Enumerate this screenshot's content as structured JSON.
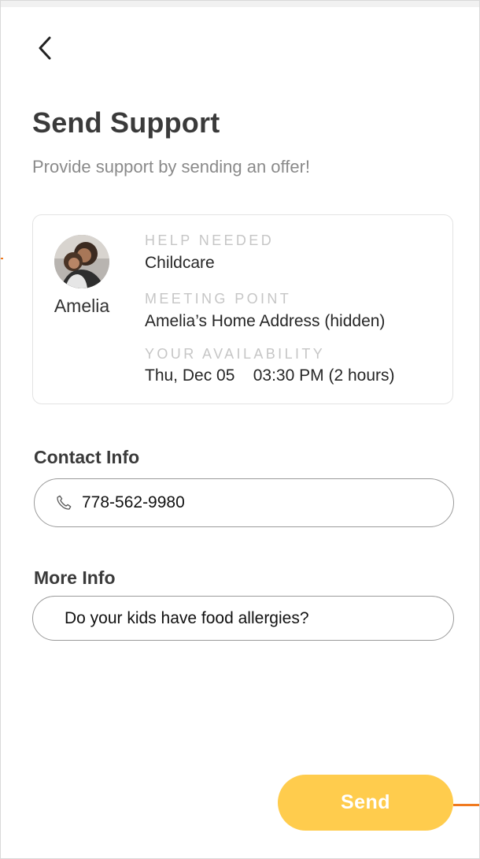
{
  "header": {
    "title": "Send Support",
    "subtitle": "Provide support by sending an offer!"
  },
  "request": {
    "person_name": "Amelia",
    "help_needed_label": "HELP NEEDED",
    "help_needed_value": "Childcare",
    "meeting_point_label": "MEETING POINT",
    "meeting_point_value": "Amelia’s Home Address (hidden)",
    "availability_label": "YOUR AVAILABILITY",
    "availability_value": "Thu, Dec 05    03:30 PM (2 hours)"
  },
  "contact": {
    "label": "Contact Info",
    "phone": "778-562-9980",
    "icon": "phone-icon"
  },
  "more_info": {
    "label": "More Info",
    "value": "Do your kids have food allergies?"
  },
  "actions": {
    "send_label": "Send"
  },
  "colors": {
    "accent": "#ffcc4d",
    "connector": "#f07a1f",
    "title": "#3a3a3a",
    "muted_label": "#c6c6c6"
  }
}
